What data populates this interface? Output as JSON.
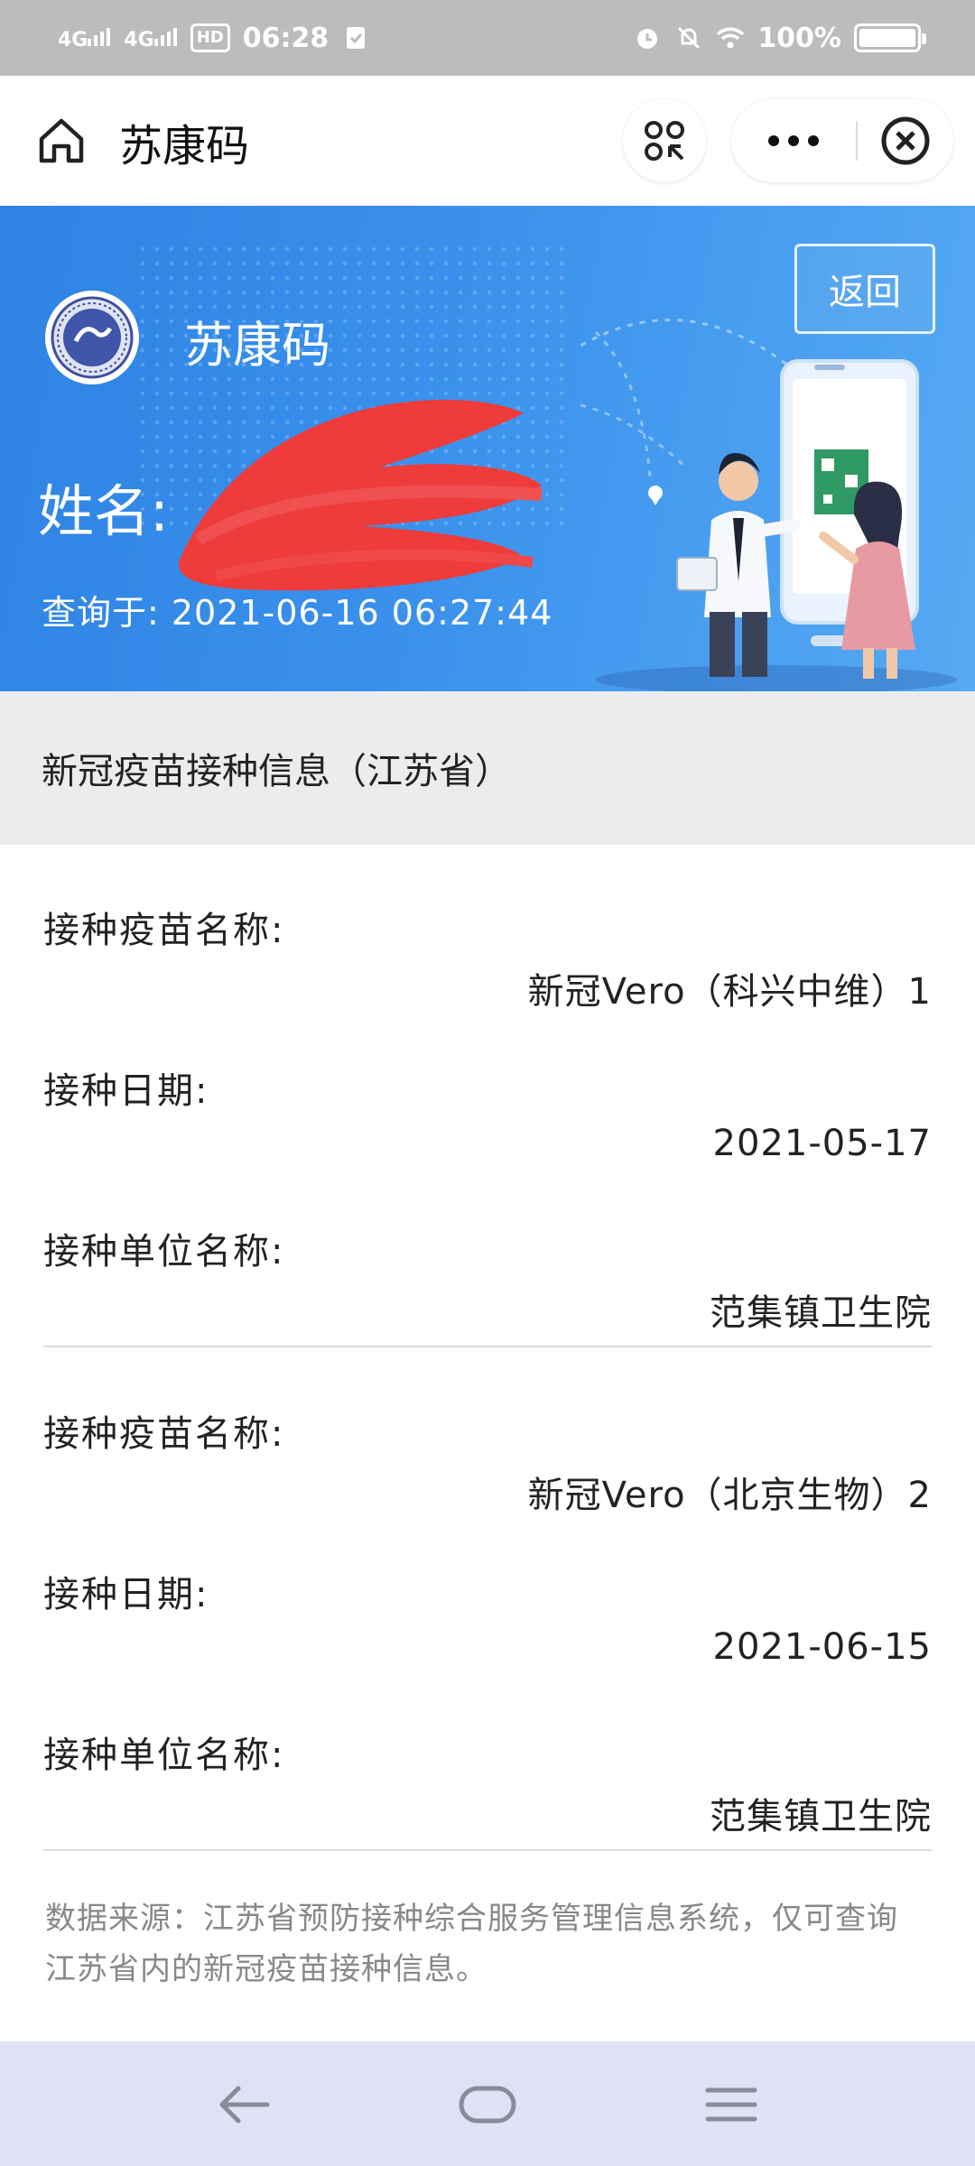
{
  "status": {
    "net1": "4G",
    "net2": "4G",
    "hd": "HD",
    "time": "06:28",
    "battery": "100%",
    "battery_level": 1.0
  },
  "titlebar": {
    "title": "苏康码",
    "icons": [
      "home-icon",
      "scan-icon",
      "more-icon",
      "close-circle-icon"
    ]
  },
  "banner": {
    "app_name": "苏康码",
    "back_label": "返回",
    "name_label": "姓名:",
    "query_text": "查询于: 2021-06-16 06:27:44",
    "colors": {
      "gradient_start": "#2f83e4",
      "gradient_end": "#56aaf3",
      "redaction": "#f04040"
    }
  },
  "section": {
    "title": "新冠疫苗接种信息（江苏省）"
  },
  "records": [
    {
      "vaccine_label": "接种疫苗名称:",
      "vaccine_value": "新冠Vero（科兴中维）1",
      "date_label": "接种日期:",
      "date_value": "2021-05-17",
      "unit_label": "接种单位名称:",
      "unit_value": "范集镇卫生院"
    },
    {
      "vaccine_label": "接种疫苗名称:",
      "vaccine_value": "新冠Vero（北京生物）2",
      "date_label": "接种日期:",
      "date_value": "2021-06-15",
      "unit_label": "接种单位名称:",
      "unit_value": "范集镇卫生院"
    }
  ],
  "footnote": "数据来源：江苏省预防接种综合服务管理信息系统，仅可查询江苏省内的新冠疫苗接种信息。",
  "navbar": {
    "icons": [
      "back-arrow-icon",
      "home-pill-icon",
      "menu-icon"
    ]
  }
}
